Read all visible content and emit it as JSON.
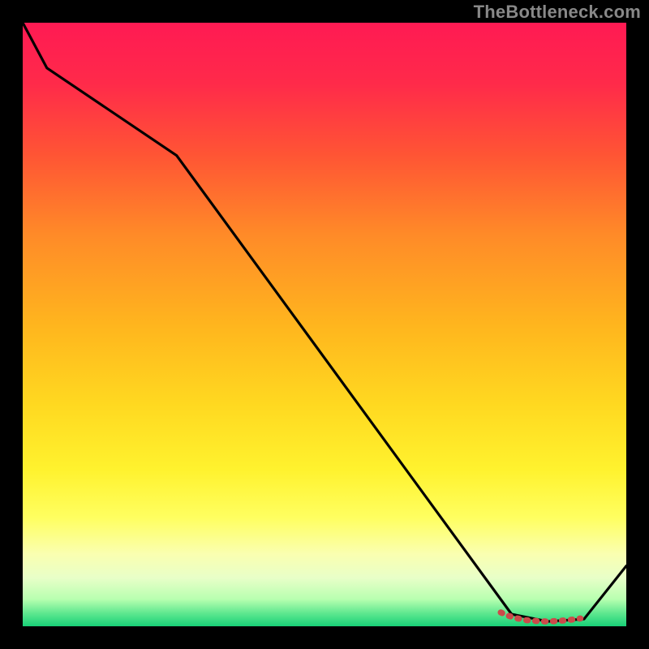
{
  "watermark": "TheBottleneck.com",
  "chart_data": {
    "type": "line",
    "title": "",
    "xlabel": "",
    "ylabel": "",
    "xlim": [
      0,
      100
    ],
    "ylim": [
      0,
      100
    ],
    "grid": false,
    "x": [
      0.0,
      4.0,
      25.5,
      81.0,
      87.0,
      93.0,
      100.0
    ],
    "values": [
      100.0,
      92.5,
      78.0,
      2.0,
      0.8,
      1.2,
      10.0
    ],
    "marker_segment": {
      "x": [
        79.2,
        80.0,
        81.5,
        83.5,
        85.5,
        87.0,
        89.0,
        91.0,
        92.4
      ],
      "values": [
        2.3,
        1.9,
        1.4,
        1.0,
        0.85,
        0.8,
        0.9,
        1.1,
        1.3
      ]
    },
    "gradient_stops": [
      {
        "offset": 0.0,
        "color": "#ff1a53"
      },
      {
        "offset": 0.1,
        "color": "#ff2a4a"
      },
      {
        "offset": 0.22,
        "color": "#ff5534"
      },
      {
        "offset": 0.35,
        "color": "#ff8a28"
      },
      {
        "offset": 0.5,
        "color": "#ffb51e"
      },
      {
        "offset": 0.63,
        "color": "#ffd820"
      },
      {
        "offset": 0.74,
        "color": "#fff22e"
      },
      {
        "offset": 0.82,
        "color": "#ffff60"
      },
      {
        "offset": 0.88,
        "color": "#faffb0"
      },
      {
        "offset": 0.92,
        "color": "#e8ffc8"
      },
      {
        "offset": 0.955,
        "color": "#b8ffb0"
      },
      {
        "offset": 0.978,
        "color": "#60e890"
      },
      {
        "offset": 1.0,
        "color": "#18d077"
      }
    ],
    "line_color": "#000000",
    "marker_color": "#cc4a4a"
  }
}
